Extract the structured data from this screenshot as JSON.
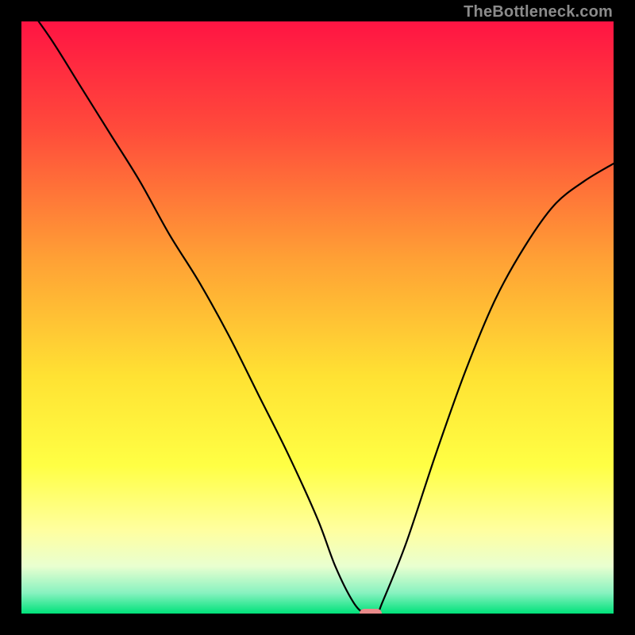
{
  "watermark": "TheBottleneck.com",
  "chart_data": {
    "type": "line",
    "title": "",
    "xlabel": "",
    "ylabel": "",
    "xlim": [
      0,
      100
    ],
    "ylim": [
      0,
      100
    ],
    "grid": false,
    "gradient_stops": [
      {
        "pos": 0.0,
        "color": "#ff1443"
      },
      {
        "pos": 0.18,
        "color": "#ff4a3b"
      },
      {
        "pos": 0.4,
        "color": "#ffa035"
      },
      {
        "pos": 0.6,
        "color": "#ffe233"
      },
      {
        "pos": 0.75,
        "color": "#ffff44"
      },
      {
        "pos": 0.86,
        "color": "#ffffa0"
      },
      {
        "pos": 0.92,
        "color": "#e9ffd0"
      },
      {
        "pos": 0.965,
        "color": "#88f2c0"
      },
      {
        "pos": 1.0,
        "color": "#00e27a"
      }
    ],
    "curve_color": "#000000",
    "x": [
      0,
      5,
      10,
      15,
      20,
      25,
      30,
      35,
      40,
      45,
      50,
      53,
      56,
      58,
      60,
      61,
      65,
      70,
      75,
      80,
      85,
      90,
      95,
      100
    ],
    "values": [
      104,
      97,
      89,
      81,
      73,
      64,
      56,
      47,
      37,
      27,
      16,
      8,
      2,
      0,
      0,
      2,
      12,
      27,
      41,
      53,
      62,
      69,
      73,
      76
    ],
    "optimal_point": {
      "x": 59,
      "y": 0,
      "color": "#e98a8a"
    }
  }
}
